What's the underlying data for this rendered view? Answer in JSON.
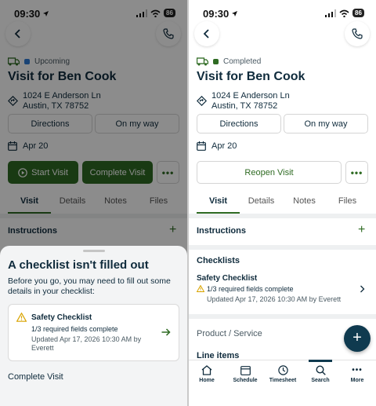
{
  "status_bar": {
    "time": "09:30",
    "battery": "86"
  },
  "left": {
    "visit_status": "Upcoming",
    "title": "Visit for Ben Cook",
    "address_line1": "1024 E Anderson Ln",
    "address_line2": "Austin, TX 78752",
    "directions": "Directions",
    "on_my_way": "On my way",
    "date": "Apr 20",
    "start_visit": "Start Visit",
    "complete_visit": "Complete Visit",
    "tabs": [
      "Visit",
      "Details",
      "Notes",
      "Files"
    ],
    "instructions": "Instructions",
    "sheet": {
      "title": "A checklist isn't filled out",
      "body": "Before you go, you may need to fill out some details in your checklist:",
      "checklist_title": "Safety Checklist",
      "checklist_status": "1/3 required fields complete",
      "checklist_updated": "Updated Apr 17, 2026 10:30 AM by Everett",
      "complete_visit": "Complete Visit"
    }
  },
  "right": {
    "visit_status": "Completed",
    "title": "Visit for Ben Cook",
    "address_line1": "1024 E Anderson Ln",
    "address_line2": "Austin, TX 78752",
    "directions": "Directions",
    "on_my_way": "On my way",
    "date": "Apr 20",
    "reopen_visit": "Reopen Visit",
    "tabs": [
      "Visit",
      "Details",
      "Notes",
      "Files"
    ],
    "instructions": "Instructions",
    "checklists": "Checklists",
    "checklist_title": "Safety Checklist",
    "checklist_status": "1/3 required fields complete",
    "checklist_updated": "Updated Apr 17, 2026 10:30 AM by Everett",
    "product_service": "Product / Service",
    "line_items": "Line items",
    "bottom_nav": [
      "Home",
      "Schedule",
      "Timesheet",
      "Search",
      "More"
    ]
  },
  "colors": {
    "brand_green": "#2f6b23",
    "upcoming": "#2e7bd6",
    "completed": "#2f6b23",
    "warning": "#d9a400"
  }
}
